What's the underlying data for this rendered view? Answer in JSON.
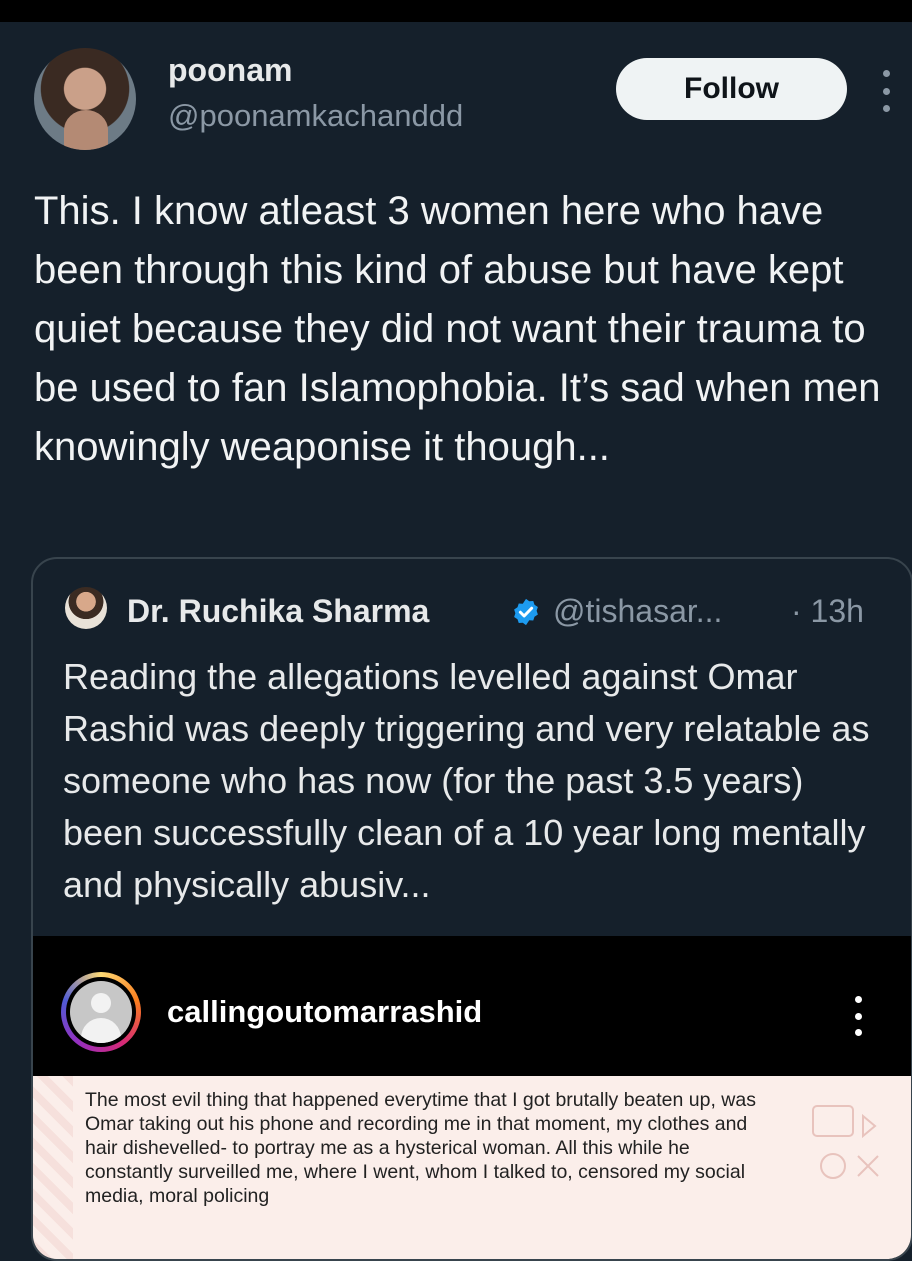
{
  "post": {
    "author_name": "poonam",
    "author_handle": "@poonamkachanddd",
    "follow_label": "Follow",
    "text": "This. I know atleast 3 women here who have been through this kind of abuse but have kept quiet because they did not want their trauma to be used to fan Islamophobia. It’s sad when men knowingly weaponise it though..."
  },
  "quote": {
    "author_name": "Dr. Ruchika Sharma",
    "author_handle": "@tishasar...",
    "time": "· 13h",
    "text": "Reading the allegations levelled against Omar Rashid was deeply triggering and very relatable as someone who has now (for the past 3.5 years) been successfully clean of a 10 year long mentally and physically abusiv...",
    "embed": {
      "username": "callingoutomarrashid",
      "text": "The most evil thing that happened everytime that I got brutally beaten up, was Omar taking out his phone and recording me in that moment, my clothes and hair dishevelled- to portray me as a hysterical woman. All this while he constantly surveilled me, where I went, whom I talked to, censored my social media, moral policing"
    }
  },
  "colors": {
    "background": "#15202b",
    "verified_blue": "#1d9bf0",
    "follow_bg": "#eff3f4"
  }
}
